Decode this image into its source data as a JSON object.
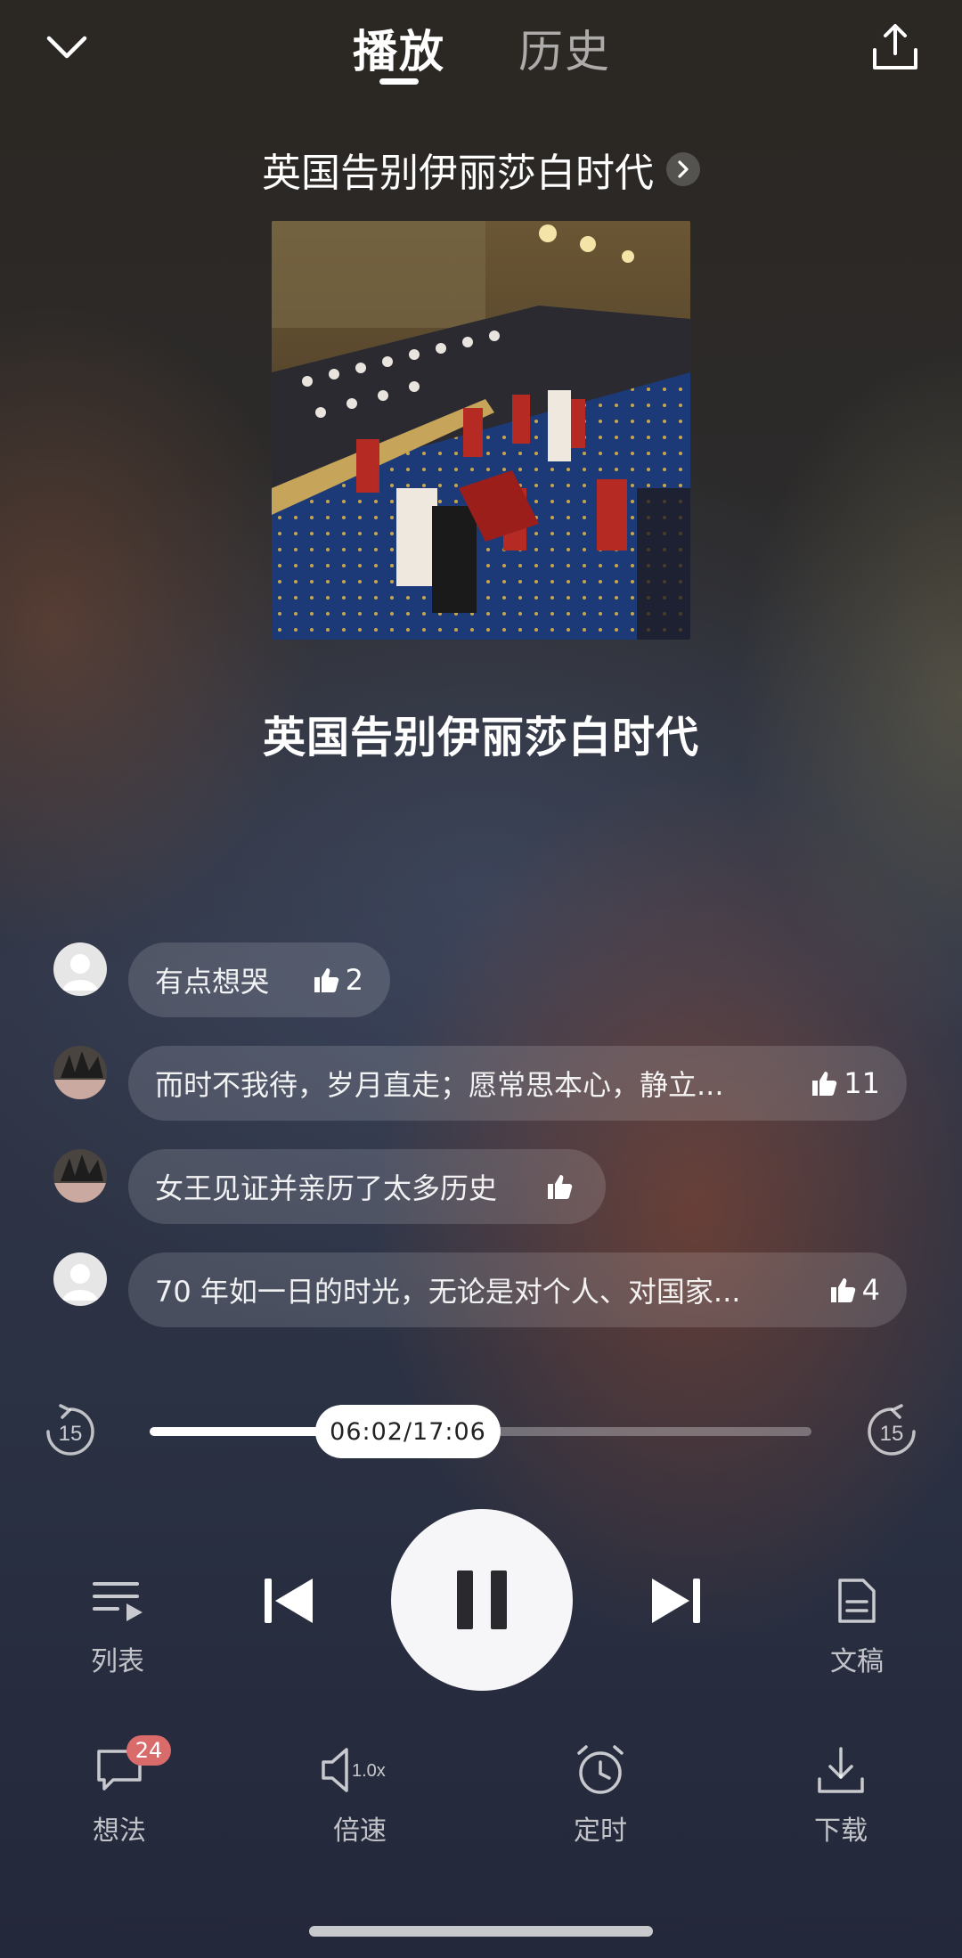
{
  "header": {
    "tabs": [
      {
        "label": "播放",
        "active": true
      },
      {
        "label": "历史",
        "active": false
      }
    ],
    "collapse_icon": "chevron-down-icon",
    "share_icon": "share-upload-icon"
  },
  "album": {
    "title": "英国告别伊丽莎白时代"
  },
  "track": {
    "title": "英国告别伊丽莎白时代"
  },
  "comments": [
    {
      "text": "有点想哭",
      "likes": "2"
    },
    {
      "text": "而时不我待，岁月直走；愿常思本心，静立...",
      "likes": "11"
    },
    {
      "text": "女王见证并亲历了太多历史",
      "likes": ""
    },
    {
      "text": "70 年如一日的时光，无论是对个人、对国家...",
      "likes": "4"
    }
  ],
  "player": {
    "time": "06:02/17:06",
    "progress": 0.3526,
    "rewind_seconds": "15",
    "forward_seconds": "15"
  },
  "controls": {
    "list_label": "列表",
    "transcript_label": "文稿"
  },
  "bottom": {
    "thoughts_label": "想法",
    "thoughts_count": "24",
    "speed_label": "倍速",
    "speed_value": "1.0x",
    "timer_label": "定时",
    "download_label": "下载"
  },
  "colors": {
    "badge": "#d96b6b",
    "play_button": "#f6f6f8"
  }
}
